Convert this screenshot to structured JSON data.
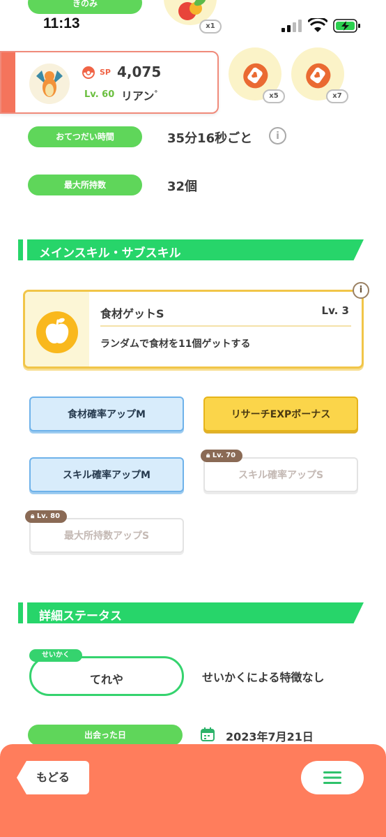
{
  "top_partial": {
    "berry_label": "きのみ",
    "berry_count": "x1"
  },
  "status_bar": {
    "time": "11:13"
  },
  "pokemon": {
    "sp_label": "SP",
    "sp_value": "4,075",
    "level": "Lv. 60",
    "name": "リアン",
    "name_suffix": "°"
  },
  "ingredients": [
    {
      "count": "x5"
    },
    {
      "count": "x7"
    }
  ],
  "info": {
    "help_time_label": "おてつだい時間",
    "help_time_value": "35分16秒ごと",
    "max_carry_label": "最大所持数",
    "max_carry_value": "32個"
  },
  "skills_section": {
    "title": "メインスキル・サブスキル"
  },
  "main_skill": {
    "name": "食材ゲットS",
    "level": "Lv. 3",
    "description": "ランダムで食材を11個ゲットする"
  },
  "sub_skills": [
    {
      "label": "食材確率アップM",
      "style": "blue"
    },
    {
      "label": "リサーチEXPボーナス",
      "style": "gold"
    },
    {
      "label": "スキル確率アップM",
      "style": "blue"
    },
    {
      "label": "スキル確率アップS",
      "style": "locked",
      "lock_level": "Lv. 70"
    },
    {
      "label": "最大所持数アップS",
      "style": "locked",
      "lock_level": "Lv. 80"
    }
  ],
  "details_section": {
    "title": "詳細ステータス"
  },
  "nature": {
    "tag": "せいかく",
    "value": "てれや",
    "effect": "せいかくによる特徴なし"
  },
  "met": {
    "label": "出会った日",
    "date": "2023年7月21日"
  },
  "bottom": {
    "back_label": "もどる"
  },
  "colors": {
    "green": "#5fd65a",
    "section_green": "#27d56a",
    "orange": "#ff7d5c",
    "gold": "#f1c548"
  }
}
